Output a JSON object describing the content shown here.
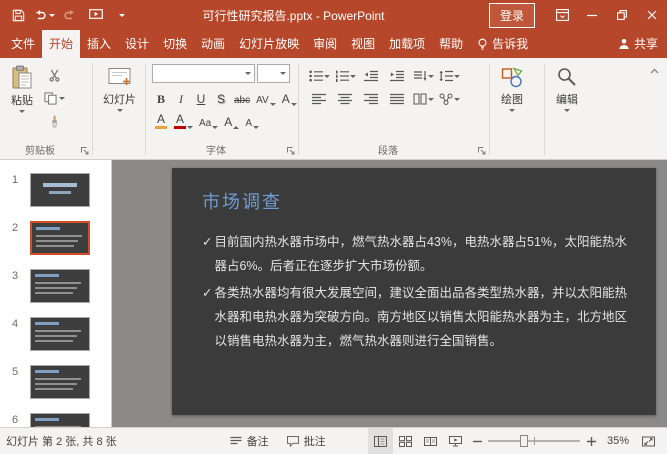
{
  "colors": {
    "titlebar": "#B7472A",
    "active_tab_text": "#B7472A",
    "slide_background": "#3B3B3B",
    "slide_title_blue": "#6E9CD3",
    "thumbnail_selection_border": "#D04E26"
  },
  "titlebar": {
    "title": "可行性研究报告.pptx - PowerPoint",
    "sign_in": "登录"
  },
  "tabs": {
    "items": [
      "文件",
      "开始",
      "插入",
      "设计",
      "切换",
      "动画",
      "幻灯片放映",
      "审阅",
      "视图",
      "加载项",
      "帮助"
    ],
    "tell_me": "告诉我",
    "share": "共享"
  },
  "ribbon": {
    "paste": "粘贴",
    "slides_button": "幻灯片",
    "groups": {
      "clipboard": "剪贴板",
      "font": "字体",
      "paragraph": "段落"
    },
    "drawing": "绘图",
    "editing": "编辑",
    "font_tools": {
      "bold": "B",
      "italic": "I",
      "underline": "U",
      "shadow": "S",
      "strikethrough": "abc",
      "spacing": "AV",
      "effects": "A",
      "clear": "A",
      "color": "A",
      "case": "Aa",
      "grow": "A",
      "shrink": "A"
    }
  },
  "panel": {
    "numbers": [
      "1",
      "2",
      "3",
      "4",
      "5",
      "6"
    ]
  },
  "slide": {
    "title": "市场调查",
    "bullet_glyph": "✓",
    "bullets": [
      "目前国内热水器市场中，燃气热水器占43%，电热水器占51%，太阳能热水器占6%。后者正在逐步扩大市场份额。",
      "各类热水器均有很大发展空间，建议全面出品各类型热水器，并以太阳能热水器和电热水器为突破方向。南方地区以销售太阳能热水器为主，北方地区以销售电热水器为主，燃气热水器则进行全国销售。"
    ]
  },
  "statusbar": {
    "slide_info": "幻灯片 第 2 张, 共 8 张",
    "notes": "备注",
    "comments": "批注",
    "zoom": "35%"
  }
}
